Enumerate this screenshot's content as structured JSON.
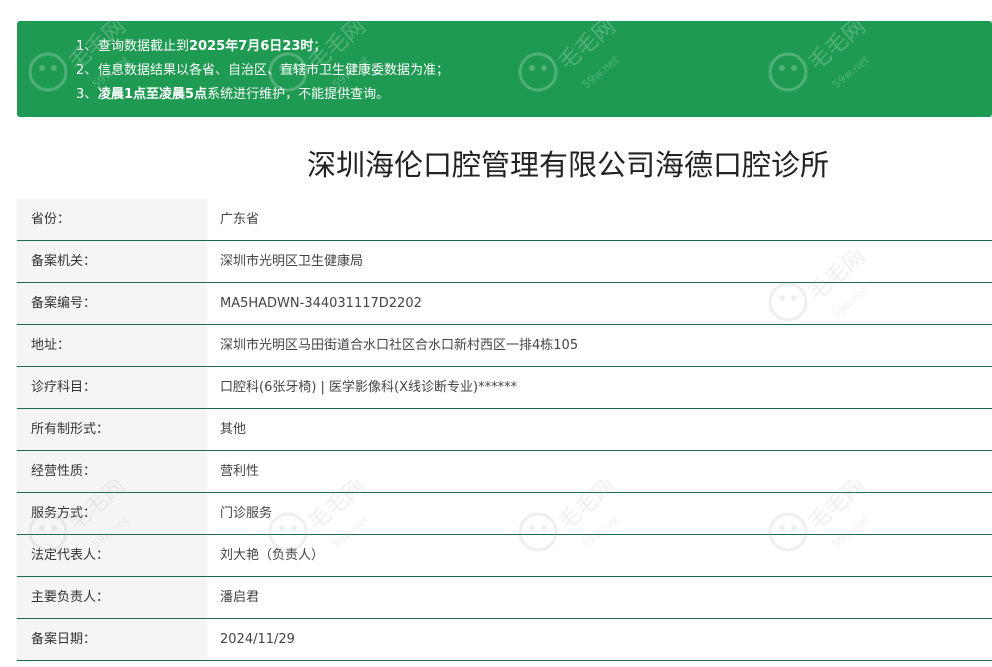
{
  "notice": {
    "items": [
      {
        "num": "1、",
        "pre": "查询数据截止到",
        "bold": "2025年7月6日23时",
        "post": "；"
      },
      {
        "num": "2、",
        "pre": "信息数据结果以各省、自治区、直辖市卫生健康委数据为准；",
        "bold": "",
        "post": ""
      },
      {
        "num": "3、",
        "pre": "",
        "bold": "凌晨1点至凌晨5点",
        "post": "系统进行维护，不能提供查询。"
      }
    ]
  },
  "title": "深圳海伦口腔管理有限公司海德口腔诊所",
  "rows": [
    {
      "label": "省份：",
      "value": "广东省"
    },
    {
      "label": "备案机关：",
      "value": "深圳市光明区卫生健康局"
    },
    {
      "label": "备案编号：",
      "value": "MA5HADWN-344031117D2202"
    },
    {
      "label": "地址：",
      "value": "深圳市光明区马田街道合水口社区合水口新村西区一排4栋105"
    },
    {
      "label": "诊疗科目：",
      "value": "口腔科(6张牙椅) | 医学影像科(X线诊断专业)******"
    },
    {
      "label": "所有制形式：",
      "value": "其他"
    },
    {
      "label": "经营性质：",
      "value": "营利性"
    },
    {
      "label": "服务方式：",
      "value": "门诊服务"
    },
    {
      "label": "法定代表人：",
      "value": "刘大艳（负责人）"
    },
    {
      "label": "主要负责人：",
      "value": "潘启君"
    },
    {
      "label": "备案日期：",
      "value": "2024/11/29"
    }
  ],
  "watermark": {
    "text_cn": "毛毛网",
    "text_en": "59w.net"
  },
  "colors": {
    "notice_bg": "#1e9a52",
    "row_border": "#1f6b52",
    "label_bg": "#f5f5f5"
  }
}
